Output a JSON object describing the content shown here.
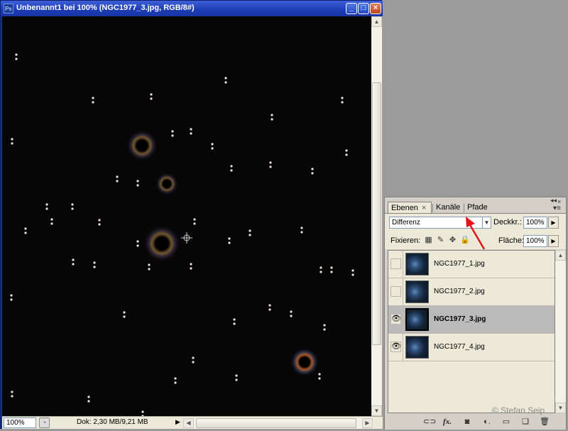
{
  "window": {
    "title": "Unbenannt1 bei 100% (NGC1977_3.jpg, RGB/8#)",
    "app_icon": "Ps",
    "minimize": "_",
    "maximize": "□",
    "close": "×"
  },
  "status": {
    "zoom": "100%",
    "doc_info": "Dok: 2,30 MB/9,21 MB",
    "menu_arrow": "▶",
    "scroll_left": "◀",
    "scroll_right": "▶",
    "scroll_up": "▲",
    "scroll_down": "▼"
  },
  "panel": {
    "tabs": [
      {
        "label": "Ebenen",
        "active": true,
        "close": "×"
      },
      {
        "label": "Kanäle",
        "active": false
      },
      {
        "label": "Pfade",
        "active": false
      }
    ],
    "blend_mode": "Differenz",
    "opacity_label": "Deckkr.:",
    "opacity_value": "100%",
    "lock_label": "Fixieren:",
    "fill_label": "Fläche:",
    "fill_value": "100%",
    "layers": [
      {
        "name": "NGC1977_1.jpg",
        "visible": false,
        "selected": false
      },
      {
        "name": "NGC1977_2.jpg",
        "visible": false,
        "selected": false
      },
      {
        "name": "NGC1977_3.jpg",
        "visible": true,
        "selected": true
      },
      {
        "name": "NGC1977_4.jpg",
        "visible": true,
        "selected": false
      }
    ],
    "footer_icons": [
      "link-icon",
      "fx-icon",
      "mask-icon",
      "adjustment-icon",
      "group-folder-icon",
      "new-layer-icon",
      "trash-icon"
    ]
  },
  "watermark": "© Stefan Seip",
  "colors": {
    "titlebar": "#1c3cb4",
    "canvas": "#070607",
    "annotation_arrow": "#e0161b",
    "selected_layer": "#bababa"
  }
}
